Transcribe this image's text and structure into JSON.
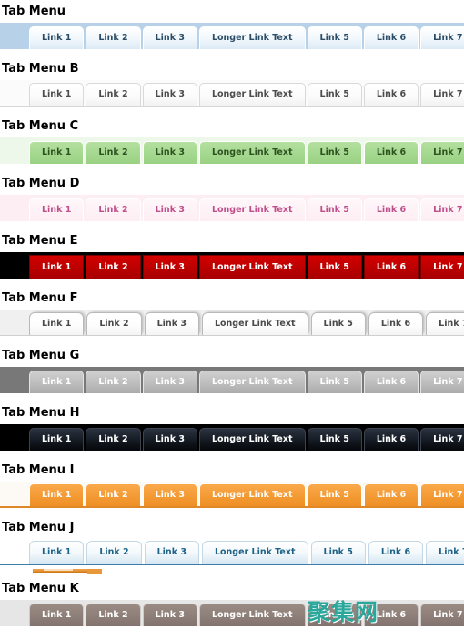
{
  "page": {
    "watermark": "聚集网",
    "link_labels": [
      "Link 1",
      "Link 2",
      "Link 3",
      "Longer Link Text",
      "Link 5",
      "Link 6",
      "Link 7"
    ],
    "colors": {
      "menu_a_bar": "#b7d2e8",
      "menu_a_text": "#2b4c66",
      "menu_b_bar": "#fbfbfb",
      "menu_b_text": "#4c4c4c",
      "menu_c_bar": "#eef8ea",
      "menu_c_tab": "#a4d88f",
      "menu_c_text": "#2e5320",
      "menu_d_bar": "#fdeef4",
      "menu_d_text": "#bf4f8a",
      "menu_e_bar": "#000000",
      "menu_e_tab": "#bb0000",
      "menu_e_text": "#ffffff",
      "menu_f_bar": "#f0f0f0",
      "menu_f_text": "#4a4a4a",
      "menu_g_bar": "#787878",
      "menu_g_tab": "#bdbdbd",
      "menu_g_text": "#ffffff",
      "menu_h_bar": "#000000",
      "menu_h_tab": "#141a22",
      "menu_h_text": "#ffffff",
      "menu_i_tab": "#f39a34",
      "menu_i_text": "#ffffff",
      "menu_j_text": "#1d6287",
      "menu_j_rule": "#3b7ca8",
      "menu_k_bar": "#e6e6e6",
      "menu_k_tab": "#8d7e78",
      "menu_k_text": "#ffffff",
      "watermark": "#2aa79b"
    }
  },
  "menus": [
    {
      "id": "a",
      "title": "Tab Menu",
      "tabs": [
        {
          "label": "Link 1"
        },
        {
          "label": "Link 2"
        },
        {
          "label": "Link 3"
        },
        {
          "label": "Longer Link Text"
        },
        {
          "label": "Link 5"
        },
        {
          "label": "Link 6"
        },
        {
          "label": "Link 7"
        }
      ]
    },
    {
      "id": "b",
      "title": "Tab Menu B",
      "tabs": [
        {
          "label": "Link 1"
        },
        {
          "label": "Link 2"
        },
        {
          "label": "Link 3"
        },
        {
          "label": "Longer Link Text"
        },
        {
          "label": "Link 5"
        },
        {
          "label": "Link 6"
        },
        {
          "label": "Link 7"
        }
      ]
    },
    {
      "id": "c",
      "title": "Tab Menu C",
      "tabs": [
        {
          "label": "Link 1"
        },
        {
          "label": "Link 2"
        },
        {
          "label": "Link 3"
        },
        {
          "label": "Longer Link Text"
        },
        {
          "label": "Link 5"
        },
        {
          "label": "Link 6"
        },
        {
          "label": "Link 7"
        }
      ]
    },
    {
      "id": "d",
      "title": "Tab Menu D",
      "tabs": [
        {
          "label": "Link 1"
        },
        {
          "label": "Link 2"
        },
        {
          "label": "Link 3"
        },
        {
          "label": "Longer Link Text"
        },
        {
          "label": "Link 5"
        },
        {
          "label": "Link 6"
        },
        {
          "label": "Link 7"
        }
      ]
    },
    {
      "id": "e",
      "title": "Tab Menu E",
      "tabs": [
        {
          "label": "Link 1"
        },
        {
          "label": "Link 2"
        },
        {
          "label": "Link 3"
        },
        {
          "label": "Longer Link Text"
        },
        {
          "label": "Link 5"
        },
        {
          "label": "Link 6"
        },
        {
          "label": "Link 7"
        }
      ]
    },
    {
      "id": "f",
      "title": "Tab Menu F",
      "tabs": [
        {
          "label": "Link 1"
        },
        {
          "label": "Link 2"
        },
        {
          "label": "Link 3"
        },
        {
          "label": "Longer Link Text"
        },
        {
          "label": "Link 5"
        },
        {
          "label": "Link 6"
        },
        {
          "label": "Link 7"
        }
      ]
    },
    {
      "id": "g",
      "title": "Tab Menu G",
      "tabs": [
        {
          "label": "Link 1"
        },
        {
          "label": "Link 2"
        },
        {
          "label": "Link 3"
        },
        {
          "label": "Longer Link Text"
        },
        {
          "label": "Link 5"
        },
        {
          "label": "Link 6"
        },
        {
          "label": "Link 7"
        }
      ]
    },
    {
      "id": "h",
      "title": "Tab Menu H",
      "tabs": [
        {
          "label": "Link 1"
        },
        {
          "label": "Link 2"
        },
        {
          "label": "Link 3"
        },
        {
          "label": "Longer Link Text"
        },
        {
          "label": "Link 5"
        },
        {
          "label": "Link 6"
        },
        {
          "label": "Link 7"
        }
      ]
    },
    {
      "id": "i",
      "title": "Tab Menu I",
      "tabs": [
        {
          "label": "Link 1"
        },
        {
          "label": "Link 2"
        },
        {
          "label": "Link 3"
        },
        {
          "label": "Longer Link Text"
        },
        {
          "label": "Link 5"
        },
        {
          "label": "Link 6"
        },
        {
          "label": "Link 7"
        }
      ]
    },
    {
      "id": "j",
      "title": "Tab Menu J",
      "tabs": [
        {
          "label": "Link 1"
        },
        {
          "label": "Link 2"
        },
        {
          "label": "Link 3"
        },
        {
          "label": "Longer Link Text"
        },
        {
          "label": "Link 5"
        },
        {
          "label": "Link 6"
        },
        {
          "label": "Link 7"
        }
      ]
    },
    {
      "id": "k",
      "title": "Tab Menu K",
      "tabs": [
        {
          "label": "Link 1"
        },
        {
          "label": "Link 2"
        },
        {
          "label": "Link 3"
        },
        {
          "label": "Longer Link Text"
        },
        {
          "label": "Link 5"
        },
        {
          "label": "Link 6"
        },
        {
          "label": "Link 7"
        }
      ]
    }
  ]
}
